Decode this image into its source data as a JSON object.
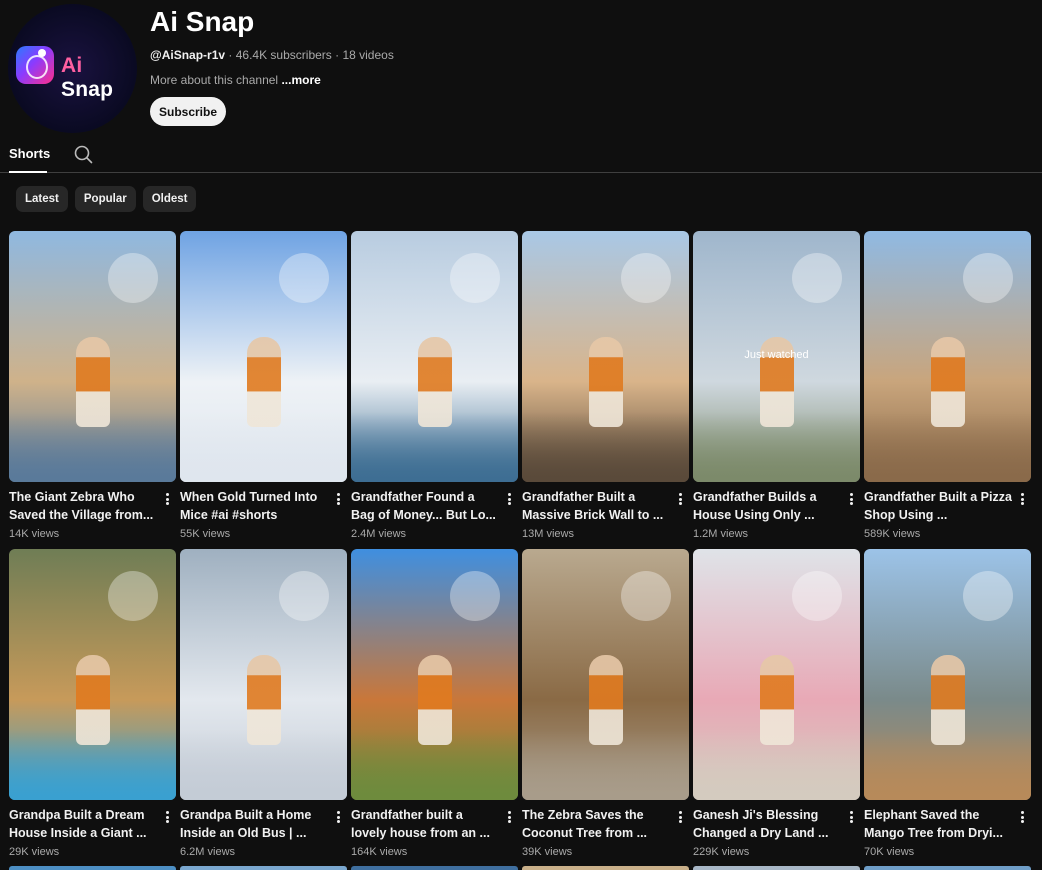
{
  "channel": {
    "name": "Ai Snap",
    "handle": "@AiSnap-r1v",
    "meta": "· 46.4K subscribers · 18 videos",
    "about": "More about this channel",
    "more": "...more",
    "subscribe_label": "Subscribe",
    "avatar_text_ai": "Ai",
    "avatar_text_snap": "Snap"
  },
  "tabs": {
    "shorts_label": "Shorts"
  },
  "chips": [
    "Latest",
    "Popular",
    "Oldest"
  ],
  "shorts": [
    {
      "title": "The Giant Zebra Who Saved the Village from...",
      "views": "14K views",
      "colors": [
        "#8fb8e0",
        "#cfb28a",
        "#5a7a9a"
      ]
    },
    {
      "title": "When Gold Turned Into Mice #ai #shorts",
      "views": "55K views",
      "colors": [
        "#6fa3e3",
        "#eef2f6",
        "#dfe6ee"
      ]
    },
    {
      "title": "Grandfather Found a Bag of Money... But Lo...",
      "views": "2.4M views",
      "colors": [
        "#b8cce0",
        "#e9eef3",
        "#3e6e93"
      ]
    },
    {
      "title": "Grandfather Built a Massive Brick Wall to ...",
      "views": "13M views",
      "colors": [
        "#a9c8e6",
        "#d9b48a",
        "#5a4a3a"
      ]
    },
    {
      "title": "Grandfather Builds a House Using Only ...",
      "views": "1.2M views",
      "colors": [
        "#9fb6cc",
        "#cfd8df",
        "#7c8a6a"
      ],
      "watched": "Just watched"
    },
    {
      "title": "Grandfather Built a Pizza Shop Using ...",
      "views": "589K views",
      "colors": [
        "#8fb9e3",
        "#c9a57c",
        "#8a6a4a"
      ]
    },
    {
      "title": "Grandpa Built a Dream House Inside a Giant ...",
      "views": "29K views",
      "colors": [
        "#6f7d55",
        "#c79a5a",
        "#3aa0d0"
      ]
    },
    {
      "title": "Grandpa Built a Home Inside an Old Bus | ...",
      "views": "6.2M views",
      "colors": [
        "#9fb0c0",
        "#e3e8ee",
        "#c4ccd6"
      ]
    },
    {
      "title": "Grandfather built a lovely house from an ...",
      "views": "164K views",
      "colors": [
        "#3f8fe0",
        "#c9773a",
        "#6e8b3d"
      ]
    },
    {
      "title": "The Zebra Saves the Coconut Tree from ...",
      "views": "39K views",
      "colors": [
        "#b9a98f",
        "#8a6a45",
        "#a89c8a"
      ]
    },
    {
      "title": "Ganesh Ji's Blessing Changed a Dry Land ...",
      "views": "229K views",
      "colors": [
        "#dfe3e8",
        "#e8a9b6",
        "#d4cbbf"
      ]
    },
    {
      "title": "Elephant Saved the Mango Tree from Dryi...",
      "views": "70K views",
      "colors": [
        "#9cc3e8",
        "#7a8a8a",
        "#b78a5a"
      ]
    }
  ]
}
